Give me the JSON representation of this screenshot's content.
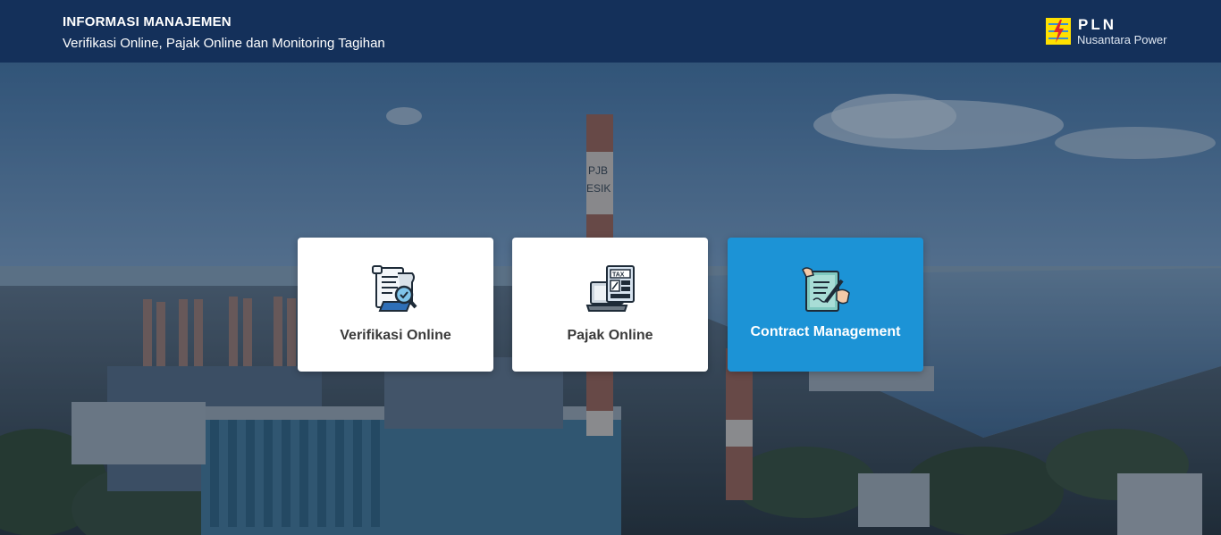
{
  "header": {
    "title": "INFORMASI MANAJEMEN",
    "subtitle": "Verifikasi Online, Pajak Online dan Monitoring Tagihan",
    "background_color": "#14305a"
  },
  "logo": {
    "name": "PLN",
    "subtitle": "Nusantara Power",
    "mark_color": "#ffe000",
    "bolt_color": "#e0262b"
  },
  "menu": {
    "cards": [
      {
        "label": "Verifikasi Online",
        "icon": "document-search-icon",
        "selected": false
      },
      {
        "label": "Pajak Online",
        "icon": "tax-laptop-icon",
        "selected": false
      },
      {
        "label": "Contract Management",
        "icon": "contract-sign-icon",
        "selected": true
      }
    ],
    "accent_color": "#1c93d6"
  },
  "background": {
    "chimney_text_1": "PJB",
    "chimney_text_2": "ESIK"
  }
}
